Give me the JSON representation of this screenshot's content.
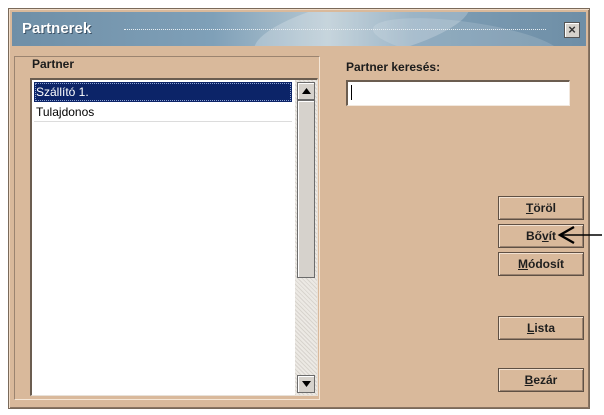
{
  "window": {
    "title": "Partnerek",
    "close_label": "×"
  },
  "partner_panel": {
    "label": "Partner",
    "items": [
      {
        "label": "Szállító 1.",
        "selected": true
      },
      {
        "label": "Tulajdonos",
        "selected": false
      }
    ]
  },
  "search": {
    "label": "Partner keresés:",
    "value": ""
  },
  "buttons": {
    "torol": {
      "access_key": "T",
      "rest": "öröl"
    },
    "bovit": {
      "pre": "Bő",
      "access_key": "v",
      "rest": "ít"
    },
    "modosit": {
      "access_key": "M",
      "rest": "ódosít"
    },
    "lista": {
      "access_key": "L",
      "rest": "ista"
    },
    "bezar": {
      "access_key": "B",
      "rest": "ezár"
    }
  },
  "colors": {
    "dialog_bg": "#d9b99b",
    "selection": "#0c2468",
    "title_gradient": "#7fa0b8"
  },
  "icons": {
    "close": "close-icon",
    "scroll_up": "arrow-up-icon",
    "scroll_down": "arrow-down-icon",
    "pointer": "arrow-left-icon"
  }
}
